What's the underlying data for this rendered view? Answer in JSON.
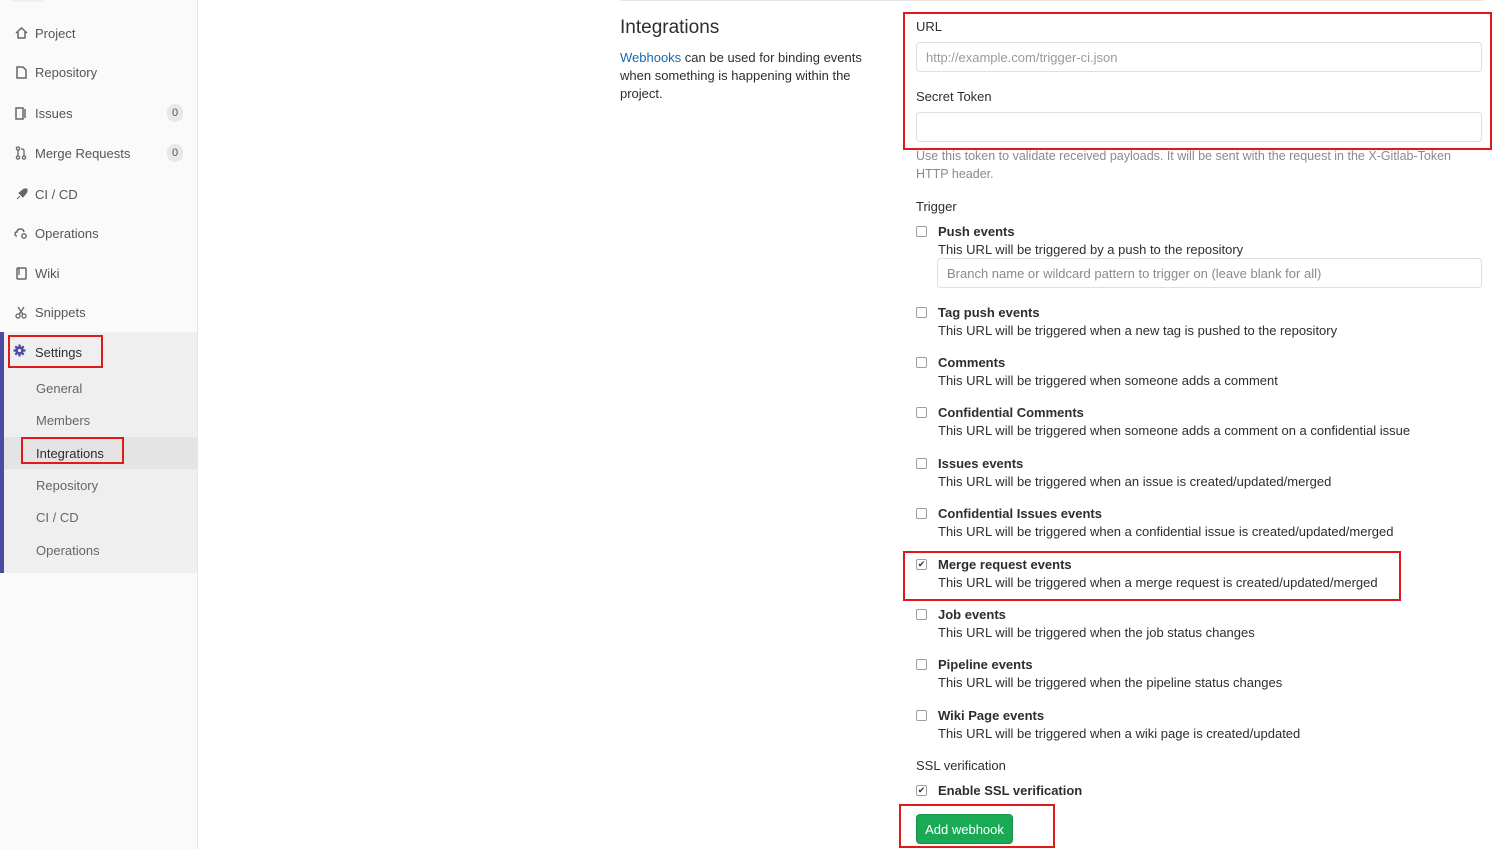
{
  "sidebar": {
    "items": [
      {
        "icon": "home-icon",
        "label": "Project"
      },
      {
        "icon": "document-icon",
        "label": "Repository"
      },
      {
        "icon": "issues-icon",
        "label": "Issues",
        "count": "0"
      },
      {
        "icon": "merge-request-icon",
        "label": "Merge Requests",
        "count": "0"
      },
      {
        "icon": "rocket-icon",
        "label": "CI / CD"
      },
      {
        "icon": "cloud-gear-icon",
        "label": "Operations"
      },
      {
        "icon": "book-icon",
        "label": "Wiki"
      },
      {
        "icon": "scissors-icon",
        "label": "Snippets"
      }
    ],
    "settings": {
      "icon": "gear-icon",
      "label": "Settings",
      "sub_items": [
        {
          "label": "General"
        },
        {
          "label": "Members"
        },
        {
          "label": "Integrations",
          "active": true
        },
        {
          "label": "Repository"
        },
        {
          "label": "CI / CD"
        },
        {
          "label": "Operations"
        }
      ]
    }
  },
  "main": {
    "title": "Integrations",
    "desc_link": "Webhooks",
    "desc_rest": " can be used for binding events when something is happening within the project.",
    "url_label": "URL",
    "url_placeholder": "http://example.com/trigger-ci.json",
    "token_label": "Secret Token",
    "token_hint": "Use this token to validate received payloads. It will be sent with the request in the X-Gitlab-Token HTTP header.",
    "trigger_label": "Trigger",
    "branch_placeholder": "Branch name or wildcard pattern to trigger on (leave blank for all)",
    "triggers": [
      {
        "title": "Push events",
        "desc": "This URL will be triggered by a push to the repository",
        "checked": false
      },
      {
        "title": "Tag push events",
        "desc": "This URL will be triggered when a new tag is pushed to the repository",
        "checked": false
      },
      {
        "title": "Comments",
        "desc": "This URL will be triggered when someone adds a comment",
        "checked": false
      },
      {
        "title": "Confidential Comments",
        "desc": "This URL will be triggered when someone adds a comment on a confidential issue",
        "checked": false
      },
      {
        "title": "Issues events",
        "desc": "This URL will be triggered when an issue is created/updated/merged",
        "checked": false
      },
      {
        "title": "Confidential Issues events",
        "desc": "This URL will be triggered when a confidential issue is created/updated/merged",
        "checked": false
      },
      {
        "title": "Merge request events",
        "desc": "This URL will be triggered when a merge request is created/updated/merged",
        "checked": true
      },
      {
        "title": "Job events",
        "desc": "This URL will be triggered when the job status changes",
        "checked": false
      },
      {
        "title": "Pipeline events",
        "desc": "This URL will be triggered when the pipeline status changes",
        "checked": false
      },
      {
        "title": "Wiki Page events",
        "desc": "This URL will be triggered when a wiki page is created/updated",
        "checked": false
      }
    ],
    "ssl_label": "SSL verification",
    "ssl_option": {
      "title": "Enable SSL verification",
      "checked": true
    },
    "submit_label": "Add webhook"
  },
  "colors": {
    "accent": "#4b4ba3",
    "highlight": "#e01a1a",
    "success": "#1aaa55",
    "link": "#1b69b6"
  }
}
